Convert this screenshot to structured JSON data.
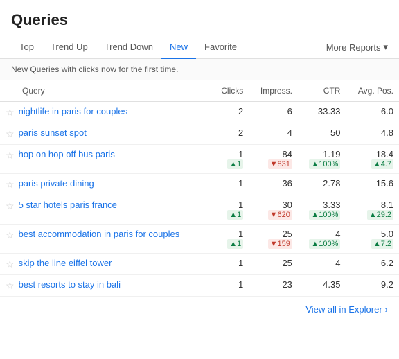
{
  "page": {
    "title": "Queries",
    "subtitle": "New Queries with clicks now for the first time.",
    "footer_link": "View all in Explorer",
    "more_reports_label": "More Reports"
  },
  "tabs": [
    {
      "id": "top",
      "label": "Top",
      "active": false
    },
    {
      "id": "trend-up",
      "label": "Trend Up",
      "active": false
    },
    {
      "id": "trend-down",
      "label": "Trend Down",
      "active": false
    },
    {
      "id": "new",
      "label": "New",
      "active": true
    },
    {
      "id": "favorite",
      "label": "Favorite",
      "active": false
    }
  ],
  "columns": [
    {
      "id": "query",
      "label": "Query",
      "type": "text"
    },
    {
      "id": "clicks",
      "label": "Clicks",
      "type": "num"
    },
    {
      "id": "impressions",
      "label": "Impress.",
      "type": "num"
    },
    {
      "id": "ctr",
      "label": "CTR",
      "type": "num"
    },
    {
      "id": "avg_pos",
      "label": "Avg. Pos.",
      "type": "num"
    }
  ],
  "rows": [
    {
      "query": "nightlife in paris for couples",
      "clicks": "2",
      "impressions": "6",
      "ctr": "33.33",
      "avg_pos": "6.0",
      "clicks_delta": null,
      "impressions_delta": null,
      "ctr_delta": null,
      "avg_pos_delta": null
    },
    {
      "query": "paris sunset spot",
      "clicks": "2",
      "impressions": "4",
      "ctr": "50",
      "avg_pos": "4.8",
      "clicks_delta": null,
      "impressions_delta": null,
      "ctr_delta": null,
      "avg_pos_delta": null
    },
    {
      "query": "hop on hop off bus paris",
      "clicks": "1",
      "impressions": "84",
      "ctr": "1.19",
      "avg_pos": "18.4",
      "clicks_delta": "+1",
      "clicks_delta_dir": "up",
      "impressions_delta": "-831",
      "impressions_delta_dir": "down",
      "ctr_delta": "▲100%",
      "ctr_delta_dir": "up",
      "avg_pos_delta": "▲4.7",
      "avg_pos_delta_dir": "up"
    },
    {
      "query": "paris private dining",
      "clicks": "1",
      "impressions": "36",
      "ctr": "2.78",
      "avg_pos": "15.6",
      "clicks_delta": null,
      "impressions_delta": null,
      "ctr_delta": null,
      "avg_pos_delta": null
    },
    {
      "query": "5 star hotels paris france",
      "clicks": "1",
      "impressions": "30",
      "ctr": "3.33",
      "avg_pos": "8.1",
      "clicks_delta": "+1",
      "clicks_delta_dir": "up",
      "impressions_delta": "-620",
      "impressions_delta_dir": "down",
      "ctr_delta": "▲100%",
      "ctr_delta_dir": "up",
      "avg_pos_delta": "▲29.2",
      "avg_pos_delta_dir": "up"
    },
    {
      "query": "best accommodation in paris for couples",
      "clicks": "1",
      "impressions": "25",
      "ctr": "4",
      "avg_pos": "5.0",
      "clicks_delta": "+1",
      "clicks_delta_dir": "up",
      "impressions_delta": "-159",
      "impressions_delta_dir": "down",
      "ctr_delta": "▲100%",
      "ctr_delta_dir": "up",
      "avg_pos_delta": "▲7.2",
      "avg_pos_delta_dir": "up"
    },
    {
      "query": "skip the line eiffel tower",
      "clicks": "1",
      "impressions": "25",
      "ctr": "4",
      "avg_pos": "6.2",
      "clicks_delta": null,
      "impressions_delta": null,
      "ctr_delta": null,
      "avg_pos_delta": null
    },
    {
      "query": "best resorts to stay in bali",
      "clicks": "1",
      "impressions": "23",
      "ctr": "4.35",
      "avg_pos": "9.2",
      "clicks_delta": null,
      "impressions_delta": null,
      "ctr_delta": null,
      "avg_pos_delta": null
    }
  ]
}
